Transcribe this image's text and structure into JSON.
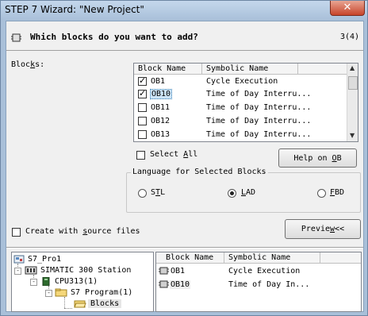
{
  "window": {
    "title": "STEP 7 Wizard: \"New Project\"",
    "close_glyph": "✕"
  },
  "header": {
    "question": "Which blocks do you want to add?",
    "step": "3(4)"
  },
  "blocks_label": {
    "pre": "Bloc",
    "accel": "k",
    "post": "s:"
  },
  "block_list": {
    "columns": [
      "Block Name",
      "Symbolic Name"
    ],
    "rows": [
      {
        "name": "OB1",
        "symbol": "Cycle Execution",
        "checked": true,
        "selected": false
      },
      {
        "name": "OB10",
        "symbol": "Time of Day Interru...",
        "checked": true,
        "selected": true
      },
      {
        "name": "OB11",
        "symbol": "Time of Day Interru...",
        "checked": false,
        "selected": false
      },
      {
        "name": "OB12",
        "symbol": "Time of Day Interru...",
        "checked": false,
        "selected": false
      },
      {
        "name": "OB13",
        "symbol": "Time of Day Interru...",
        "checked": false,
        "selected": false
      }
    ]
  },
  "select_all": {
    "pre": "Select ",
    "accel": "A",
    "post": "ll"
  },
  "help_button": {
    "pre": "Help on ",
    "accel": "O",
    "post": "B"
  },
  "language_group": {
    "title": "Language for Selected Blocks",
    "options": [
      {
        "pre": "S",
        "accel": "T",
        "post": "L",
        "selected": false
      },
      {
        "pre": "",
        "accel": "L",
        "post": "AD",
        "selected": true
      },
      {
        "pre": "",
        "accel": "F",
        "post": "BD",
        "selected": false
      }
    ]
  },
  "create_source": {
    "pre": "Create with ",
    "accel": "s",
    "post": "ource files"
  },
  "preview_button": {
    "pre": "Previe",
    "accel": "w",
    "post": "<<"
  },
  "tree": {
    "items": [
      "S7_Pro1",
      "SIMATIC 300 Station",
      "CPU313(1)",
      "S7 Program(1)",
      "Blocks"
    ]
  },
  "preview_list": {
    "columns": [
      "Block Name",
      "Symbolic Name"
    ],
    "rows": [
      {
        "name": "OB1",
        "symbol": "Cycle Execution"
      },
      {
        "name": "OB10",
        "symbol": "Time of Day In..."
      }
    ]
  },
  "colors": {
    "window_frame": "#a9c0d9",
    "close_button": "#c7442a",
    "selection": "#cce4f7",
    "folder": "#f5d77a"
  }
}
